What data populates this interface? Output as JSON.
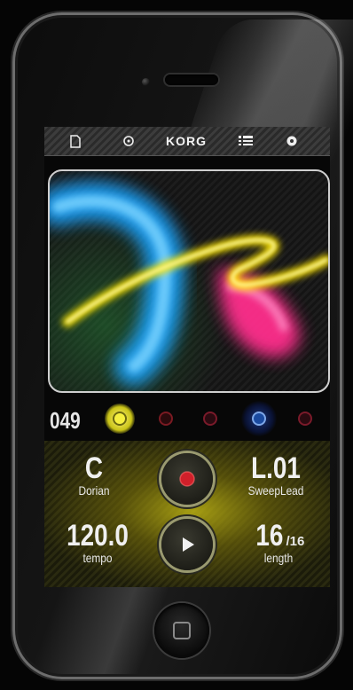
{
  "topbar": {
    "brand": "KORG",
    "icons": [
      "document-icon",
      "gear-small-icon",
      "list-icon",
      "settings-icon"
    ]
  },
  "pattern": {
    "number": "049"
  },
  "slots": [
    {
      "state": "active",
      "color": "#e8e520"
    },
    {
      "state": "idle",
      "color": "#7a1a22"
    },
    {
      "state": "idle",
      "color": "#7a1a2a"
    },
    {
      "state": "selected",
      "color": "#1a4aa0"
    },
    {
      "state": "idle",
      "color": "#7a1a2a"
    }
  ],
  "key": {
    "value": "C",
    "label": "Dorian"
  },
  "preset": {
    "value": "L.01",
    "label": "SweepLead"
  },
  "tempo": {
    "value": "120.0",
    "label": "tempo"
  },
  "length": {
    "value": "16",
    "suffix": "/16",
    "label": "length"
  },
  "colors": {
    "accent_yellow": "#e8e520",
    "trail_blue": "#1ba6ff",
    "trail_pink": "#ff2d8c",
    "record": "#d0202a"
  }
}
